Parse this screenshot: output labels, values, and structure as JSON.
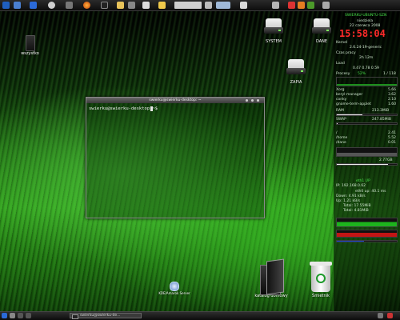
{
  "colors": {
    "accent_green": "#48e24a",
    "clock_red": "#ff2a2a",
    "panel": "#1a1a1a"
  },
  "top_panel": {
    "launchers": [
      "kde-menu-icon",
      "network-icon",
      "desktop-icon",
      "link-icon",
      "firefox-icon",
      "terminal-icon",
      "folder-icon",
      "clipboard-icon"
    ]
  },
  "desktop": {
    "icons": [
      {
        "name": "wszystko",
        "label": "wszystko"
      },
      {
        "name": "system",
        "label": "SYSTEM"
      },
      {
        "name": "dane",
        "label": "DANE"
      },
      {
        "name": "zapia",
        "label": "ZAPIA"
      },
      {
        "name": "katalog-domowy",
        "label": "katalog domowy"
      },
      {
        "name": "smietnik",
        "label": "Śmietnik"
      },
      {
        "name": "ksplash",
        "label": "KDE/Amarok Server"
      }
    ]
  },
  "terminal": {
    "title": "swierku@swierku-desktop: ~",
    "prompt_line": "swierku@swierku-desktop:~$"
  },
  "conky": {
    "hostname": "SWIERKU-UBUNTU-SZN",
    "weekday": "niedziela",
    "date": "22 czerwca 2008",
    "time": "15:58:04",
    "kernel_label": "Kernel",
    "kernel": "2.6.24-19-generic",
    "uptime_label": "Czas pracy",
    "uptime": "2h 12m",
    "load_label": "Load",
    "load": "0.47 0.78 0.59",
    "processes_label": "Procesy",
    "processes": "1 / 118",
    "cpu_label": "CPU",
    "cpu": "52%",
    "top_procs": [
      {
        "name": "Xorg",
        "val": "5.66"
      },
      {
        "name": "beryl-manager",
        "val": "3.62"
      },
      {
        "name": "conky",
        "val": "2.10"
      },
      {
        "name": "gnome-term-applet",
        "val": "1.60"
      }
    ],
    "ram_label": "RAM",
    "ram_percent": 42,
    "ram": "213.3MiB",
    "swap_label": "SWAP",
    "swap_percent": 1,
    "swap": "247.85MiB",
    "hdd": [
      {
        "name": "/",
        "val": "2.41"
      },
      {
        "name": "/home",
        "val": "5.52"
      },
      {
        "name": "/dane",
        "val": "0.01"
      }
    ],
    "net_label": "eth1 UP",
    "ip": "IP: 192.168.0.62",
    "speed": "eth0 up: 40.1 ms",
    "down": "Down: 4.91 kB/s",
    "up": "Up: 1.21 kB/s",
    "total_down": "Total: 17.55MiB",
    "total_up": "Total: 4.81MiB",
    "temp": "2.77GB"
  },
  "taskbar": {
    "active_task": "swierku@swierku-de..."
  }
}
